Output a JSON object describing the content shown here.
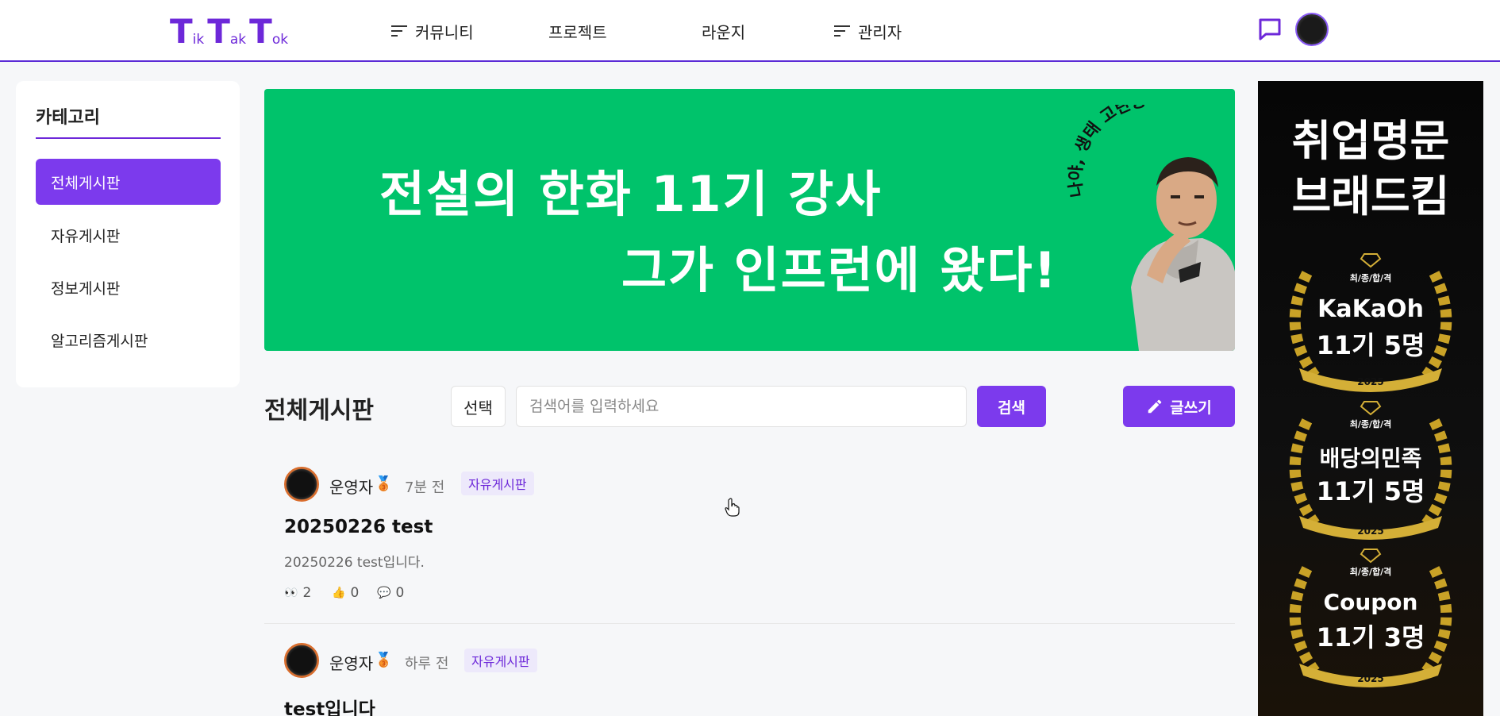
{
  "header": {
    "logo": {
      "t1": "T",
      "s1": "ik",
      "t2": "T",
      "s2": "ak",
      "t3": "T",
      "s3": "ok"
    },
    "nav": [
      {
        "label": "커뮤니티",
        "has_menu_icon": true
      },
      {
        "label": "프로젝트",
        "has_menu_icon": false
      },
      {
        "label": "라운지",
        "has_menu_icon": false
      },
      {
        "label": "관리자",
        "has_menu_icon": true
      }
    ],
    "icons": {
      "chat": "chat-bubble-icon",
      "avatar": "user-avatar"
    }
  },
  "sidebar": {
    "title": "카테고리",
    "items": [
      {
        "label": "전체게시판",
        "active": true
      },
      {
        "label": "자유게시판",
        "active": false
      },
      {
        "label": "정보게시판",
        "active": false
      },
      {
        "label": "알고리즘게시판",
        "active": false
      }
    ]
  },
  "banner": {
    "line1": "전설의 한화 11기 강사",
    "line2": "그가 인프런에 왔다!",
    "arc_text": "나야, 생태 고란종"
  },
  "toolbar": {
    "board_title": "전체게시판",
    "select_label": "선택",
    "search_placeholder": "검색어를 입력하세요",
    "search_button": "검색",
    "write_button": "글쓰기"
  },
  "posts": [
    {
      "author": "운영자",
      "medal": "🥉",
      "time": "7분 전",
      "tag": "자유게시판",
      "title": "20250226 test",
      "body": "20250226 test입니다.",
      "views_icon": "👀",
      "views": "2",
      "likes_icon": "👍",
      "likes": "0",
      "comments_icon": "💬",
      "comments": "0"
    },
    {
      "author": "운영자",
      "medal": "🥉",
      "time": "하루 전",
      "tag": "자유게시판",
      "title": "test입니다"
    }
  ],
  "ad": {
    "title1": "취업명문",
    "title2": "브래드킴",
    "badges": [
      {
        "small": "최/종/합/격",
        "line1": "KaKaOh",
        "line2": "11기 5명",
        "year": "2025"
      },
      {
        "small": "최/종/합/격",
        "line1": "배당의민족",
        "line2": "11기 5명",
        "year": "2025"
      },
      {
        "small": "최/종/합/격",
        "line1": "Coupon",
        "line2": "11기 3명",
        "year": "2025"
      }
    ]
  },
  "colors": {
    "accent": "#7c3aed",
    "banner_bg": "#00c36b",
    "header_border": "#5b2bd6"
  }
}
